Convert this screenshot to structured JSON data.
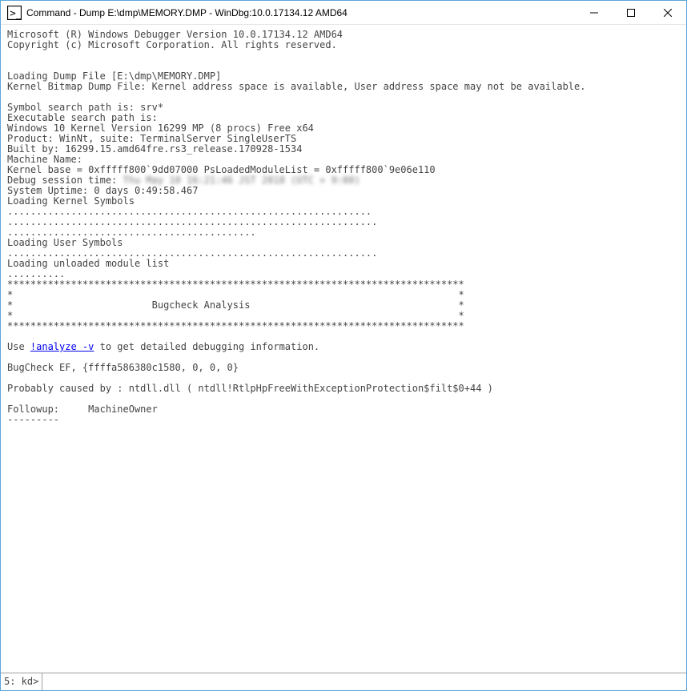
{
  "window": {
    "title": "Command - Dump E:\\dmp\\MEMORY.DMP - WinDbg:10.0.17134.12 AMD64"
  },
  "output": {
    "line01": "Microsoft (R) Windows Debugger Version 10.0.17134.12 AMD64",
    "line02": "Copyright (c) Microsoft Corporation. All rights reserved.",
    "blank": "",
    "line03": "Loading Dump File [E:\\dmp\\MEMORY.DMP]",
    "line04": "Kernel Bitmap Dump File: Kernel address space is available, User address space may not be available.",
    "line05": "Symbol search path is: srv*",
    "line06": "Executable search path is: ",
    "line07": "Windows 10 Kernel Version 16299 MP (8 procs) Free x64",
    "line08": "Product: WinNt, suite: TerminalServer SingleUserTS",
    "line09": "Built by: 16299.15.amd64fre.rs3_release.170928-1534",
    "line10": "Machine Name:",
    "line11": "Kernel base = 0xfffff800`9dd07000 PsLoadedModuleList = 0xfffff800`9e06e110",
    "line12a": "Debug session time: ",
    "line12b": "Thu May 10 16:21:46 JST 2018 (UTC + 9:00)",
    "line13": "System Uptime: 0 days 0:49:58.467",
    "line14": "Loading Kernel Symbols",
    "dots1": "...............................................................",
    "dots2": "................................................................",
    "dots3": "...........................................",
    "line15": "Loading User Symbols",
    "dots4": "................................................................",
    "line16": "Loading unloaded module list",
    "dots5": "..........",
    "stars": "*******************************************************************************",
    "starblank": "*                                                                             *",
    "starhdr": "*                        Bugcheck Analysis                                    *",
    "use_pre": "Use ",
    "analyze_link": "!analyze -v",
    "use_post": " to get detailed debugging information.",
    "bugcheck": "BugCheck EF, {ffffa586380c1580, 0, 0, 0}",
    "probably": "Probably caused by : ntdll.dll ( ntdll!RtlpHpFreeWithExceptionProtection$filt$0+44 )",
    "followup": "Followup:     MachineOwner",
    "dashes": "---------"
  },
  "status": {
    "prompt": "5: kd>",
    "input_value": ""
  }
}
